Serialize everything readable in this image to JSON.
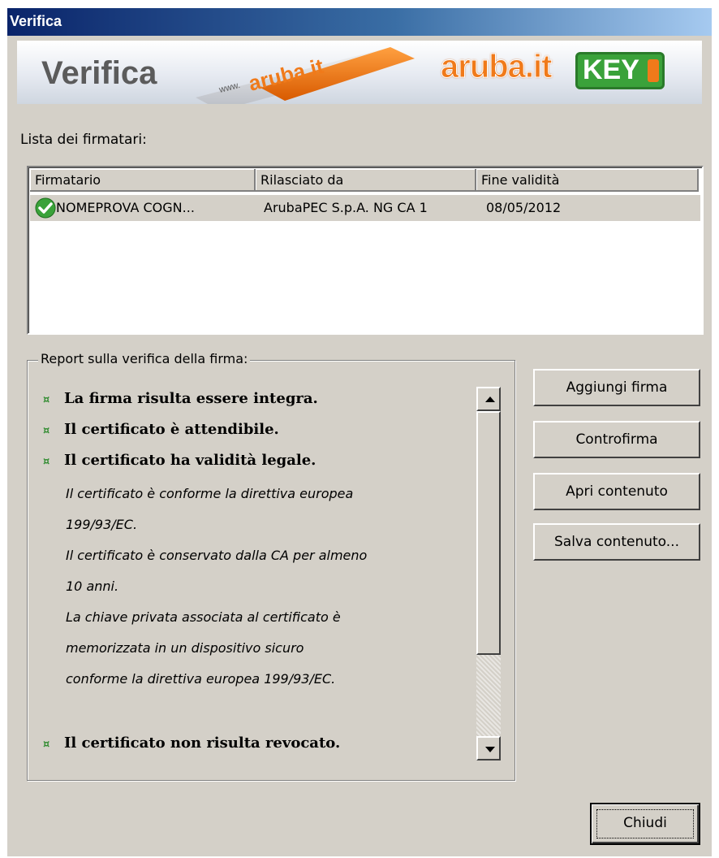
{
  "window": {
    "title": "Verifica"
  },
  "banner": {
    "title": "Verifica",
    "brand": "aruba.it",
    "brand_key": "KEY",
    "usb_text": "www.aruba.it"
  },
  "signers": {
    "label": "Lista dei firmatari:",
    "columns": [
      "Firmatario",
      "Rilasciato da",
      "Fine validità"
    ],
    "rows": [
      {
        "signer": "NOMEPROVA COGN...",
        "issuer": "ArubaPEC S.p.A. NG CA 1",
        "expiry": "08/05/2012",
        "icon": "check-circle-icon"
      }
    ]
  },
  "report": {
    "legend": "Report sulla verifica della firma:",
    "bullet": "¤",
    "lines": [
      {
        "text": "La firma risulta essere integra.",
        "style": "bold"
      },
      {
        "text": "Il certificato è attendibile.",
        "style": "bold"
      },
      {
        "text": "Il certificato ha validità legale.",
        "style": "bold"
      },
      {
        "text": "Il certificato è conforme la direttiva europea",
        "style": "italic"
      },
      {
        "text": "199/93/EC.",
        "style": "italic"
      },
      {
        "text": "Il certificato è conservato dalla CA per almeno",
        "style": "italic"
      },
      {
        "text": "10 anni.",
        "style": "italic"
      },
      {
        "text": "La chiave privata associata al certificato è",
        "style": "italic"
      },
      {
        "text": "memorizzata in un dispositivo sicuro",
        "style": "italic"
      },
      {
        "text": "conforme la direttiva europea 199/93/EC.",
        "style": "italic"
      },
      {
        "text": "Il certificato non risulta revocato.",
        "style": "bold"
      }
    ]
  },
  "buttons": {
    "add_signature": "Aggiungi firma",
    "countersign": "Controfirma",
    "open_content": "Apri contenuto",
    "save_content": "Salva contenuto...",
    "close": "Chiudi"
  },
  "colors": {
    "titlebar": "#0a246a",
    "accent_green": "#2e8b2e",
    "brand_orange": "#f07a1a",
    "face": "#d4d0c8"
  }
}
